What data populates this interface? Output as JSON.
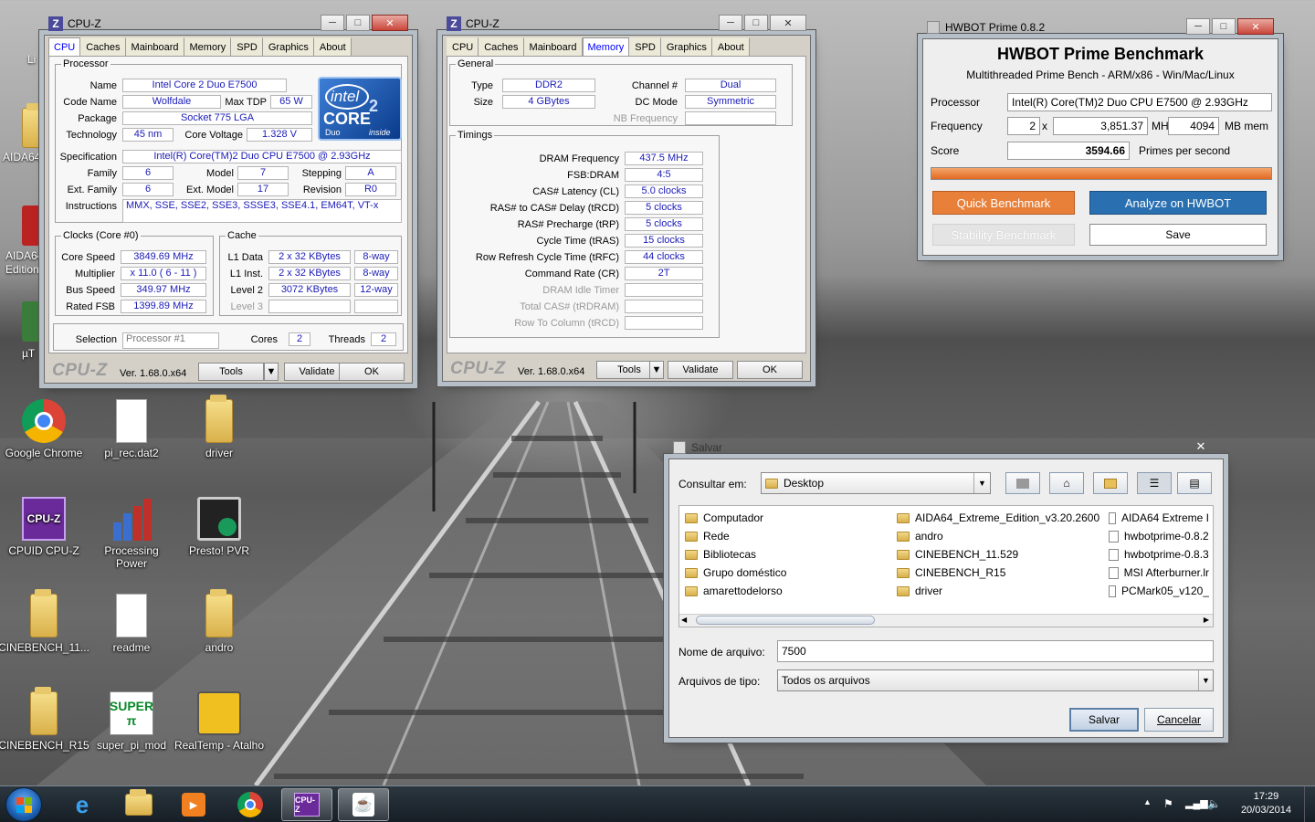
{
  "desktop": {
    "icons": [
      {
        "label": "Google Chrome",
        "icon": "chrome-icon"
      },
      {
        "label": "pi_rec.dat2",
        "icon": "document-icon"
      },
      {
        "label": "driver",
        "icon": "folder-icon"
      },
      {
        "label": "CPUID CPU-Z",
        "icon": "cpuz-icon"
      },
      {
        "label": "Processing\nPower",
        "icon": "bar-chart-icon"
      },
      {
        "label": "Presto! PVR",
        "icon": "tv-icon"
      },
      {
        "label": "CINEBENCH_11...",
        "icon": "folder-icon"
      },
      {
        "label": "readme",
        "icon": "document-icon"
      },
      {
        "label": "andro",
        "icon": "folder-icon"
      },
      {
        "label": "CINEBENCH_R15",
        "icon": "folder-icon"
      },
      {
        "label": "super_pi_mod",
        "icon": "superpi-icon"
      },
      {
        "label": "RealTemp - Atalho",
        "icon": "realtemp-icon"
      }
    ],
    "partial_labels": {
      "li": "Li",
      "aida1": "AIDA64",
      "aida2": "AIDA64",
      "edition": "Edition",
      "ut": "µT"
    }
  },
  "cpuz1": {
    "title": "CPU-Z",
    "tabs": [
      "CPU",
      "Caches",
      "Mainboard",
      "Memory",
      "SPD",
      "Graphics",
      "About"
    ],
    "active_tab": "CPU",
    "processor_legend": "Processor",
    "labels": {
      "name": "Name",
      "codename": "Code Name",
      "maxtdp": "Max TDP",
      "package": "Package",
      "technology": "Technology",
      "corevoltage": "Core Voltage",
      "specification": "Specification",
      "family": "Family",
      "model": "Model",
      "stepping": "Stepping",
      "extfamily": "Ext. Family",
      "extmodel": "Ext. Model",
      "revision": "Revision",
      "instructions": "Instructions"
    },
    "values": {
      "name": "Intel Core 2 Duo E7500",
      "codename": "Wolfdale",
      "maxtdp": "65 W",
      "package": "Socket 775 LGA",
      "technology": "45 nm",
      "corevoltage": "1.328 V",
      "specification": "Intel(R) Core(TM)2 Duo CPU     E7500  @ 2.93GHz",
      "family": "6",
      "model": "7",
      "stepping": "A",
      "extfamily": "6",
      "extmodel": "17",
      "revision": "R0",
      "instructions": "MMX, SSE, SSE2, SSE3, SSSE3, SSE4.1, EM64T, VT-x"
    },
    "intel_badge": {
      "brand": "intel",
      "core": "CORE",
      "two": "2",
      "duo": "Duo",
      "inside": "inside"
    },
    "clocks_legend": "Clocks (Core #0)",
    "clocks": {
      "corespeed_l": "Core Speed",
      "corespeed": "3849.69 MHz",
      "multiplier_l": "Multiplier",
      "multiplier": "x 11.0 ( 6 - 11 )",
      "busspeed_l": "Bus Speed",
      "busspeed": "349.97 MHz",
      "ratedfsb_l": "Rated FSB",
      "ratedfsb": "1399.89 MHz"
    },
    "cache_legend": "Cache",
    "cache": [
      {
        "label": "L1 Data",
        "size": "2 x 32 KBytes",
        "way": "8-way"
      },
      {
        "label": "L1 Inst.",
        "size": "2 x 32 KBytes",
        "way": "8-way"
      },
      {
        "label": "Level 2",
        "size": "3072 KBytes",
        "way": "12-way"
      },
      {
        "label": "Level 3",
        "size": "",
        "way": ""
      }
    ],
    "selection_l": "Selection",
    "selection": "Processor #1",
    "cores_l": "Cores",
    "cores": "2",
    "threads_l": "Threads",
    "threads": "2",
    "logo": "CPU-Z",
    "version": "Ver. 1.68.0.x64",
    "tools": "Tools",
    "validate": "Validate",
    "ok": "OK"
  },
  "cpuz2": {
    "title": "CPU-Z",
    "tabs": [
      "CPU",
      "Caches",
      "Mainboard",
      "Memory",
      "SPD",
      "Graphics",
      "About"
    ],
    "active_tab": "Memory",
    "general_legend": "General",
    "general": {
      "type_l": "Type",
      "type": "DDR2",
      "channel_l": "Channel #",
      "channel": "Dual",
      "size_l": "Size",
      "size": "4 GBytes",
      "dcmode_l": "DC Mode",
      "dcmode": "Symmetric",
      "nbfreq_l": "NB Frequency",
      "nbfreq": ""
    },
    "timings_legend": "Timings",
    "timings": [
      {
        "label": "DRAM Frequency",
        "value": "437.5 MHz",
        "dim": false
      },
      {
        "label": "FSB:DRAM",
        "value": "4:5",
        "dim": false
      },
      {
        "label": "CAS# Latency (CL)",
        "value": "5.0 clocks",
        "dim": false
      },
      {
        "label": "RAS# to CAS# Delay (tRCD)",
        "value": "5 clocks",
        "dim": false
      },
      {
        "label": "RAS# Precharge (tRP)",
        "value": "5 clocks",
        "dim": false
      },
      {
        "label": "Cycle Time (tRAS)",
        "value": "15 clocks",
        "dim": false
      },
      {
        "label": "Row Refresh Cycle Time (tRFC)",
        "value": "44 clocks",
        "dim": false
      },
      {
        "label": "Command Rate (CR)",
        "value": "2T",
        "dim": false
      },
      {
        "label": "DRAM Idle Timer",
        "value": "",
        "dim": true
      },
      {
        "label": "Total CAS# (tRDRAM)",
        "value": "",
        "dim": true
      },
      {
        "label": "Row To Column (tRCD)",
        "value": "",
        "dim": true
      }
    ],
    "logo": "CPU-Z",
    "version": "Ver. 1.68.0.x64",
    "tools": "Tools",
    "validate": "Validate",
    "ok": "OK"
  },
  "hwbot": {
    "title": "HWBOT Prime 0.8.2",
    "heading": "HWBOT Prime Benchmark",
    "subheading": "Multithreaded Prime Bench - ARM/x86 - Win/Mac/Linux",
    "processor_l": "Processor",
    "processor": "Intel(R) Core(TM)2 Duo CPU     E7500  @ 2.93GHz",
    "frequency_l": "Frequency",
    "threads": "2",
    "x": "x",
    "freq": "3,851.37",
    "mhz": "MHz",
    "mem": "4094",
    "mbmem": "MB mem",
    "score_l": "Score",
    "score": "3594.66",
    "primes": "Primes per second",
    "progress": 1.0,
    "quick": "Quick Benchmark",
    "analyze": "Analyze on HWBOT",
    "stability": "Stability Benchmark",
    "save": "Save",
    "colors": {
      "orange": "#e8803a",
      "blue": "#2a6fb0"
    }
  },
  "save_dialog": {
    "title": "Salvar",
    "lookin_l": "Consultar em:",
    "lookin": "Desktop",
    "files": [
      {
        "name": "Computador",
        "kind": "folder"
      },
      {
        "name": "Rede",
        "kind": "folder"
      },
      {
        "name": "Bibliotecas",
        "kind": "folder"
      },
      {
        "name": "Grupo doméstico",
        "kind": "folder"
      },
      {
        "name": "amarettodelorso",
        "kind": "folder"
      },
      {
        "name": "AIDA64_Extreme_Edition_v3.20.2600",
        "kind": "folder"
      },
      {
        "name": "andro",
        "kind": "folder"
      },
      {
        "name": "CINEBENCH_11.529",
        "kind": "folder"
      },
      {
        "name": "CINEBENCH_R15",
        "kind": "folder"
      },
      {
        "name": "driver",
        "kind": "folder"
      },
      {
        "name": "AIDA64 Extreme I",
        "kind": "file"
      },
      {
        "name": "hwbotprime-0.8.2",
        "kind": "file"
      },
      {
        "name": "hwbotprime-0.8.3",
        "kind": "file"
      },
      {
        "name": "MSI Afterburner.lr",
        "kind": "file"
      },
      {
        "name": "PCMark05_v120_",
        "kind": "file"
      }
    ],
    "filename_l": "Nome de arquivo:",
    "filename": "7500",
    "filetype_l": "Arquivos de tipo:",
    "filetype": "Todos os arquivos",
    "save": "Salvar",
    "cancel": "Cancelar"
  },
  "taskbar": {
    "time": "17:29",
    "date": "20/03/2014",
    "items": [
      "start-button",
      "internet-explorer-icon",
      "explorer-icon",
      "media-player-icon",
      "chrome-icon",
      "cpuz-icon",
      "java-icon"
    ]
  }
}
